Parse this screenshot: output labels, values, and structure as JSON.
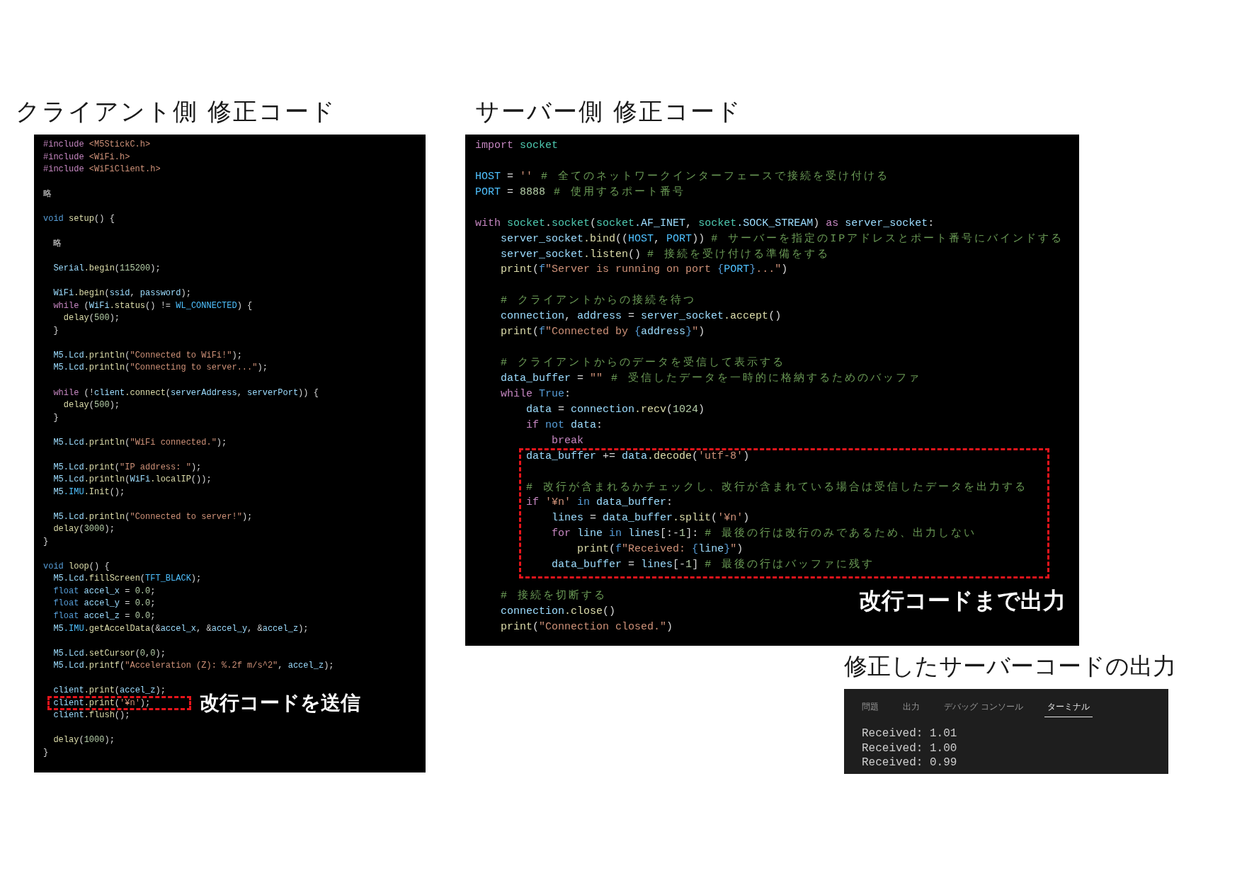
{
  "client_code": {
    "title": "クライアント側 修正コード",
    "sections": [
      {
        "highlighted": false,
        "lines": [
          {
            "kind": "code",
            "tokens": [
              {
                "kind": "keyword",
                "text": "#include"
              },
              {
                "kind": "string",
                "text": " <M5StickC.h>"
              }
            ]
          },
          {
            "kind": "code",
            "tokens": [
              {
                "kind": "keyword",
                "text": "#include"
              },
              {
                "kind": "string",
                "text": " <WiFi.h>"
              }
            ]
          },
          {
            "kind": "code",
            "tokens": [
              {
                "kind": "keyword",
                "text": "#include"
              },
              {
                "kind": "string",
                "text": " <WiFiClient.h>"
              }
            ]
          },
          {
            "kind": "blank"
          },
          {
            "kind": "code",
            "tokens": [
              {
                "kind": "plain",
                "text": "略"
              }
            ]
          },
          {
            "kind": "blank"
          },
          {
            "kind": "code",
            "tokens": [
              {
                "kind": "type",
                "text": "void"
              },
              {
                "kind": "function",
                "text": " setup"
              },
              {
                "kind": "plain",
                "text": "() {"
              }
            ]
          },
          {
            "kind": "blank"
          },
          {
            "kind": "code",
            "tokens": [
              {
                "kind": "plain",
                "text": "  略"
              }
            ]
          },
          {
            "kind": "blank"
          },
          {
            "kind": "code",
            "tokens": [
              {
                "kind": "variable",
                "text": "  Serial"
              },
              {
                "kind": "function",
                "text": ".begin"
              },
              {
                "kind": "plain",
                "text": "("
              },
              {
                "kind": "number",
                "text": "115200"
              },
              {
                "kind": "plain",
                "text": ");"
              }
            ]
          },
          {
            "kind": "blank"
          },
          {
            "kind": "code",
            "tokens": [
              {
                "kind": "variable",
                "text": "  WiFi"
              },
              {
                "kind": "function",
                "text": ".begin"
              },
              {
                "kind": "plain",
                "text": "("
              },
              {
                "kind": "variable",
                "text": "ssid"
              },
              {
                "kind": "plain",
                "text": ", "
              },
              {
                "kind": "variable",
                "text": "password"
              },
              {
                "kind": "plain",
                "text": ");"
              }
            ]
          },
          {
            "kind": "code",
            "tokens": [
              {
                "kind": "keyword",
                "text": "  while"
              },
              {
                "kind": "plain",
                "text": " ("
              },
              {
                "kind": "variable",
                "text": "WiFi"
              },
              {
                "kind": "function",
                "text": ".status"
              },
              {
                "kind": "plain",
                "text": "() != "
              },
              {
                "kind": "constant",
                "text": "WL_CONNECTED"
              },
              {
                "kind": "plain",
                "text": ") {"
              }
            ]
          },
          {
            "kind": "code",
            "tokens": [
              {
                "kind": "function",
                "text": "    delay"
              },
              {
                "kind": "plain",
                "text": "("
              },
              {
                "kind": "number",
                "text": "500"
              },
              {
                "kind": "plain",
                "text": ");"
              }
            ]
          },
          {
            "kind": "code",
            "tokens": [
              {
                "kind": "plain",
                "text": "  }"
              }
            ]
          },
          {
            "kind": "blank"
          },
          {
            "kind": "code",
            "tokens": [
              {
                "kind": "variable",
                "text": "  M5"
              },
              {
                "kind": "variable",
                "text": ".Lcd"
              },
              {
                "kind": "function",
                "text": ".println"
              },
              {
                "kind": "plain",
                "text": "("
              },
              {
                "kind": "string",
                "text": "\"Connected to WiFi!\""
              },
              {
                "kind": "plain",
                "text": ");"
              }
            ]
          },
          {
            "kind": "code",
            "tokens": [
              {
                "kind": "variable",
                "text": "  M5"
              },
              {
                "kind": "variable",
                "text": ".Lcd"
              },
              {
                "kind": "function",
                "text": ".println"
              },
              {
                "kind": "plain",
                "text": "("
              },
              {
                "kind": "string",
                "text": "\"Connecting to server...\""
              },
              {
                "kind": "plain",
                "text": ");"
              }
            ]
          },
          {
            "kind": "blank"
          },
          {
            "kind": "code",
            "tokens": [
              {
                "kind": "keyword",
                "text": "  while"
              },
              {
                "kind": "plain",
                "text": " (!"
              },
              {
                "kind": "variable",
                "text": "client"
              },
              {
                "kind": "function",
                "text": ".connect"
              },
              {
                "kind": "plain",
                "text": "("
              },
              {
                "kind": "variable",
                "text": "serverAddress"
              },
              {
                "kind": "plain",
                "text": ", "
              },
              {
                "kind": "variable",
                "text": "serverPort"
              },
              {
                "kind": "plain",
                "text": ")) {"
              }
            ]
          },
          {
            "kind": "code",
            "tokens": [
              {
                "kind": "function",
                "text": "    delay"
              },
              {
                "kind": "plain",
                "text": "("
              },
              {
                "kind": "number",
                "text": "500"
              },
              {
                "kind": "plain",
                "text": ");"
              }
            ]
          },
          {
            "kind": "code",
            "tokens": [
              {
                "kind": "plain",
                "text": "  }"
              }
            ]
          },
          {
            "kind": "blank"
          },
          {
            "kind": "code",
            "tokens": [
              {
                "kind": "variable",
                "text": "  M5"
              },
              {
                "kind": "variable",
                "text": ".Lcd"
              },
              {
                "kind": "function",
                "text": ".println"
              },
              {
                "kind": "plain",
                "text": "("
              },
              {
                "kind": "string",
                "text": "\"WiFi connected.\""
              },
              {
                "kind": "plain",
                "text": ");"
              }
            ]
          },
          {
            "kind": "blank"
          },
          {
            "kind": "code",
            "tokens": [
              {
                "kind": "variable",
                "text": "  M5"
              },
              {
                "kind": "variable",
                "text": ".Lcd"
              },
              {
                "kind": "function",
                "text": ".print"
              },
              {
                "kind": "plain",
                "text": "("
              },
              {
                "kind": "string",
                "text": "\"IP address: \""
              },
              {
                "kind": "plain",
                "text": ");"
              }
            ]
          },
          {
            "kind": "code",
            "tokens": [
              {
                "kind": "variable",
                "text": "  M5"
              },
              {
                "kind": "variable",
                "text": ".Lcd"
              },
              {
                "kind": "function",
                "text": ".println"
              },
              {
                "kind": "plain",
                "text": "("
              },
              {
                "kind": "variable",
                "text": "WiFi"
              },
              {
                "kind": "function",
                "text": ".localIP"
              },
              {
                "kind": "plain",
                "text": "());"
              }
            ]
          },
          {
            "kind": "code",
            "tokens": [
              {
                "kind": "variable",
                "text": "  M5"
              },
              {
                "kind": "constant",
                "text": ".IMU"
              },
              {
                "kind": "function",
                "text": ".Init"
              },
              {
                "kind": "plain",
                "text": "();"
              }
            ]
          },
          {
            "kind": "blank"
          },
          {
            "kind": "code",
            "tokens": [
              {
                "kind": "variable",
                "text": "  M5"
              },
              {
                "kind": "variable",
                "text": ".Lcd"
              },
              {
                "kind": "function",
                "text": ".println"
              },
              {
                "kind": "plain",
                "text": "("
              },
              {
                "kind": "string",
                "text": "\"Connected to server!\""
              },
              {
                "kind": "plain",
                "text": ");"
              }
            ]
          },
          {
            "kind": "code",
            "tokens": [
              {
                "kind": "function",
                "text": "  delay"
              },
              {
                "kind": "plain",
                "text": "("
              },
              {
                "kind": "number",
                "text": "3000"
              },
              {
                "kind": "plain",
                "text": ");"
              }
            ]
          },
          {
            "kind": "code",
            "tokens": [
              {
                "kind": "plain",
                "text": "}"
              }
            ]
          },
          {
            "kind": "blank"
          },
          {
            "kind": "code",
            "tokens": [
              {
                "kind": "type",
                "text": "void"
              },
              {
                "kind": "function",
                "text": " loop"
              },
              {
                "kind": "plain",
                "text": "() {"
              }
            ]
          },
          {
            "kind": "code",
            "tokens": [
              {
                "kind": "variable",
                "text": "  M5"
              },
              {
                "kind": "variable",
                "text": ".Lcd"
              },
              {
                "kind": "function",
                "text": ".fillScreen"
              },
              {
                "kind": "plain",
                "text": "("
              },
              {
                "kind": "constant",
                "text": "TFT_BLACK"
              },
              {
                "kind": "plain",
                "text": ");"
              }
            ]
          },
          {
            "kind": "code",
            "tokens": [
              {
                "kind": "type",
                "text": "  float"
              },
              {
                "kind": "variable",
                "text": " accel_x"
              },
              {
                "kind": "plain",
                "text": " = "
              },
              {
                "kind": "number",
                "text": "0.0"
              },
              {
                "kind": "plain",
                "text": ";"
              }
            ]
          },
          {
            "kind": "code",
            "tokens": [
              {
                "kind": "type",
                "text": "  float"
              },
              {
                "kind": "variable",
                "text": " accel_y"
              },
              {
                "kind": "plain",
                "text": " = "
              },
              {
                "kind": "number",
                "text": "0.0"
              },
              {
                "kind": "plain",
                "text": ";"
              }
            ]
          },
          {
            "kind": "code",
            "tokens": [
              {
                "kind": "type",
                "text": "  float"
              },
              {
                "kind": "variable",
                "text": " accel_z"
              },
              {
                "kind": "plain",
                "text": " = "
              },
              {
                "kind": "number",
                "text": "0.0"
              },
              {
                "kind": "plain",
                "text": ";"
              }
            ]
          },
          {
            "kind": "code",
            "tokens": [
              {
                "kind": "variable",
                "text": "  M5"
              },
              {
                "kind": "constant",
                "text": ".IMU"
              },
              {
                "kind": "function",
                "text": ".getAccelData"
              },
              {
                "kind": "plain",
                "text": "(&"
              },
              {
                "kind": "variable",
                "text": "accel_x"
              },
              {
                "kind": "plain",
                "text": ", &"
              },
              {
                "kind": "variable",
                "text": "accel_y"
              },
              {
                "kind": "plain",
                "text": ", &"
              },
              {
                "kind": "variable",
                "text": "accel_z"
              },
              {
                "kind": "plain",
                "text": ");"
              }
            ]
          },
          {
            "kind": "blank"
          },
          {
            "kind": "code",
            "tokens": [
              {
                "kind": "variable",
                "text": "  M5"
              },
              {
                "kind": "variable",
                "text": ".Lcd"
              },
              {
                "kind": "function",
                "text": ".setCursor"
              },
              {
                "kind": "plain",
                "text": "("
              },
              {
                "kind": "number",
                "text": "0"
              },
              {
                "kind": "plain",
                "text": ","
              },
              {
                "kind": "number",
                "text": "0"
              },
              {
                "kind": "plain",
                "text": ");"
              }
            ]
          },
          {
            "kind": "code",
            "tokens": [
              {
                "kind": "variable",
                "text": "  M5"
              },
              {
                "kind": "variable",
                "text": ".Lcd"
              },
              {
                "kind": "function",
                "text": ".printf"
              },
              {
                "kind": "plain",
                "text": "("
              },
              {
                "kind": "string",
                "text": "\"Acceleration (Z): %.2f m/s^2\""
              },
              {
                "kind": "plain",
                "text": ", "
              },
              {
                "kind": "variable",
                "text": "accel_z"
              },
              {
                "kind": "plain",
                "text": ");"
              }
            ]
          },
          {
            "kind": "blank"
          },
          {
            "kind": "code",
            "tokens": [
              {
                "kind": "variable",
                "text": "  client"
              },
              {
                "kind": "function",
                "text": ".print"
              },
              {
                "kind": "plain",
                "text": "("
              },
              {
                "kind": "variable",
                "text": "accel_z"
              },
              {
                "kind": "plain",
                "text": ");"
              }
            ]
          }
        ]
      },
      {
        "highlighted": true,
        "annotation": "改行コードを送信",
        "lines": [
          {
            "kind": "code",
            "tokens": [
              {
                "kind": "variable",
                "text": "  client"
              },
              {
                "kind": "function",
                "text": ".print"
              },
              {
                "kind": "plain",
                "text": "("
              },
              {
                "kind": "string",
                "text": "'¥n'"
              },
              {
                "kind": "plain",
                "text": ");"
              }
            ]
          }
        ]
      },
      {
        "highlighted": false,
        "lines": [
          {
            "kind": "code",
            "tokens": [
              {
                "kind": "variable",
                "text": "  client"
              },
              {
                "kind": "function",
                "text": ".flush"
              },
              {
                "kind": "plain",
                "text": "();"
              }
            ]
          },
          {
            "kind": "blank"
          },
          {
            "kind": "code",
            "tokens": [
              {
                "kind": "function",
                "text": "  delay"
              },
              {
                "kind": "plain",
                "text": "("
              },
              {
                "kind": "number",
                "text": "1000"
              },
              {
                "kind": "plain",
                "text": ");"
              }
            ]
          },
          {
            "kind": "code",
            "tokens": [
              {
                "kind": "plain",
                "text": "}"
              }
            ]
          }
        ]
      }
    ]
  },
  "server_code": {
    "title": "サーバー側 修正コード",
    "sections": [
      {
        "highlighted": false,
        "lines": [
          {
            "kind": "code",
            "tokens": [
              {
                "kind": "keyword",
                "text": "import"
              },
              {
                "kind": "module",
                "text": " socket"
              }
            ]
          },
          {
            "kind": "blank"
          },
          {
            "kind": "code",
            "tokens": [
              {
                "kind": "constant",
                "text": "HOST"
              },
              {
                "kind": "plain",
                "text": " = "
              },
              {
                "kind": "string",
                "text": "''"
              },
              {
                "kind": "comment",
                "text": " # 全てのネットワークインターフェースで接続を受け付ける"
              }
            ]
          },
          {
            "kind": "code",
            "tokens": [
              {
                "kind": "constant",
                "text": "PORT"
              },
              {
                "kind": "plain",
                "text": " = "
              },
              {
                "kind": "number",
                "text": "8888"
              },
              {
                "kind": "comment",
                "text": " # 使用するポート番号"
              }
            ]
          },
          {
            "kind": "blank"
          },
          {
            "kind": "code",
            "tokens": [
              {
                "kind": "keyword",
                "text": "with"
              },
              {
                "kind": "module",
                "text": " socket"
              },
              {
                "kind": "plain",
                "text": "."
              },
              {
                "kind": "module",
                "text": "socket"
              },
              {
                "kind": "plain",
                "text": "("
              },
              {
                "kind": "module",
                "text": "socket"
              },
              {
                "kind": "variable",
                "text": ".AF_INET"
              },
              {
                "kind": "plain",
                "text": ", "
              },
              {
                "kind": "module",
                "text": "socket"
              },
              {
                "kind": "variable",
                "text": ".SOCK_STREAM"
              },
              {
                "kind": "plain",
                "text": ") "
              },
              {
                "kind": "keyword",
                "text": "as"
              },
              {
                "kind": "variable",
                "text": " server_socket"
              },
              {
                "kind": "plain",
                "text": ":"
              }
            ]
          },
          {
            "kind": "code",
            "tokens": [
              {
                "kind": "variable",
                "text": "    server_socket"
              },
              {
                "kind": "function",
                "text": ".bind"
              },
              {
                "kind": "plain",
                "text": "(("
              },
              {
                "kind": "constant",
                "text": "HOST"
              },
              {
                "kind": "plain",
                "text": ", "
              },
              {
                "kind": "constant",
                "text": "PORT"
              },
              {
                "kind": "plain",
                "text": ")) "
              },
              {
                "kind": "comment",
                "text": "# サーバーを指定のIPアドレスとポート番号にバインドする"
              }
            ]
          },
          {
            "kind": "code",
            "tokens": [
              {
                "kind": "variable",
                "text": "    server_socket"
              },
              {
                "kind": "function",
                "text": ".listen"
              },
              {
                "kind": "plain",
                "text": "() "
              },
              {
                "kind": "comment",
                "text": "# 接続を受け付ける準備をする"
              }
            ]
          },
          {
            "kind": "code",
            "tokens": [
              {
                "kind": "function",
                "text": "    print"
              },
              {
                "kind": "plain",
                "text": "("
              },
              {
                "kind": "type",
                "text": "f"
              },
              {
                "kind": "string",
                "text": "\"Server is running on port "
              },
              {
                "kind": "type",
                "text": "{"
              },
              {
                "kind": "constant",
                "text": "PORT"
              },
              {
                "kind": "type",
                "text": "}"
              },
              {
                "kind": "string",
                "text": "...\""
              },
              {
                "kind": "plain",
                "text": ")"
              }
            ]
          },
          {
            "kind": "blank"
          },
          {
            "kind": "code",
            "tokens": [
              {
                "kind": "comment",
                "text": "    # クライアントからの接続を待つ"
              }
            ]
          },
          {
            "kind": "code",
            "tokens": [
              {
                "kind": "variable",
                "text": "    connection"
              },
              {
                "kind": "plain",
                "text": ", "
              },
              {
                "kind": "variable",
                "text": "address"
              },
              {
                "kind": "plain",
                "text": " = "
              },
              {
                "kind": "variable",
                "text": "server_socket"
              },
              {
                "kind": "function",
                "text": ".accept"
              },
              {
                "kind": "plain",
                "text": "()"
              }
            ]
          },
          {
            "kind": "code",
            "tokens": [
              {
                "kind": "function",
                "text": "    print"
              },
              {
                "kind": "plain",
                "text": "("
              },
              {
                "kind": "type",
                "text": "f"
              },
              {
                "kind": "string",
                "text": "\"Connected by "
              },
              {
                "kind": "type",
                "text": "{"
              },
              {
                "kind": "variable",
                "text": "address"
              },
              {
                "kind": "type",
                "text": "}"
              },
              {
                "kind": "string",
                "text": "\""
              },
              {
                "kind": "plain",
                "text": ")"
              }
            ]
          },
          {
            "kind": "blank"
          },
          {
            "kind": "code",
            "tokens": [
              {
                "kind": "comment",
                "text": "    # クライアントからのデータを受信して表示する"
              }
            ]
          },
          {
            "kind": "code",
            "tokens": [
              {
                "kind": "variable",
                "text": "    data_buffer"
              },
              {
                "kind": "plain",
                "text": " = "
              },
              {
                "kind": "string",
                "text": "\"\""
              },
              {
                "kind": "comment",
                "text": " # 受信したデータを一時的に格納するためのバッファ"
              }
            ]
          },
          {
            "kind": "code",
            "tokens": [
              {
                "kind": "keyword",
                "text": "    while"
              },
              {
                "kind": "type",
                "text": " True"
              },
              {
                "kind": "plain",
                "text": ":"
              }
            ]
          },
          {
            "kind": "code",
            "tokens": [
              {
                "kind": "variable",
                "text": "        data"
              },
              {
                "kind": "plain",
                "text": " = "
              },
              {
                "kind": "variable",
                "text": "connection"
              },
              {
                "kind": "function",
                "text": ".recv"
              },
              {
                "kind": "plain",
                "text": "("
              },
              {
                "kind": "number",
                "text": "1024"
              },
              {
                "kind": "plain",
                "text": ")"
              }
            ]
          },
          {
            "kind": "code",
            "tokens": [
              {
                "kind": "keyword",
                "text": "        if"
              },
              {
                "kind": "type",
                "text": " not"
              },
              {
                "kind": "variable",
                "text": " data"
              },
              {
                "kind": "plain",
                "text": ":"
              }
            ]
          },
          {
            "kind": "code",
            "tokens": [
              {
                "kind": "keyword",
                "text": "            break"
              }
            ]
          }
        ]
      },
      {
        "highlighted": true,
        "annotation": "改行コードまで出力",
        "lines": [
          {
            "kind": "code",
            "tokens": [
              {
                "kind": "variable",
                "text": "        data_buffer"
              },
              {
                "kind": "plain",
                "text": " += "
              },
              {
                "kind": "variable",
                "text": "data"
              },
              {
                "kind": "function",
                "text": ".decode"
              },
              {
                "kind": "plain",
                "text": "("
              },
              {
                "kind": "string",
                "text": "'utf-8'"
              },
              {
                "kind": "plain",
                "text": ")"
              }
            ]
          },
          {
            "kind": "blank"
          },
          {
            "kind": "code",
            "tokens": [
              {
                "kind": "comment",
                "text": "        # 改行が含まれるかチェックし、改行が含まれている場合は受信したデータを出力する"
              }
            ]
          },
          {
            "kind": "code",
            "tokens": [
              {
                "kind": "keyword",
                "text": "        if"
              },
              {
                "kind": "string",
                "text": " '¥n'"
              },
              {
                "kind": "type",
                "text": " in"
              },
              {
                "kind": "variable",
                "text": " data_buffer"
              },
              {
                "kind": "plain",
                "text": ":"
              }
            ]
          },
          {
            "kind": "code",
            "tokens": [
              {
                "kind": "variable",
                "text": "            lines"
              },
              {
                "kind": "plain",
                "text": " = "
              },
              {
                "kind": "variable",
                "text": "data_buffer"
              },
              {
                "kind": "function",
                "text": ".split"
              },
              {
                "kind": "plain",
                "text": "("
              },
              {
                "kind": "string",
                "text": "'¥n'"
              },
              {
                "kind": "plain",
                "text": ")"
              }
            ]
          },
          {
            "kind": "code",
            "tokens": [
              {
                "kind": "keyword",
                "text": "            for"
              },
              {
                "kind": "variable",
                "text": " line"
              },
              {
                "kind": "type",
                "text": " in"
              },
              {
                "kind": "variable",
                "text": " lines"
              },
              {
                "kind": "plain",
                "text": "[:-"
              },
              {
                "kind": "number",
                "text": "1"
              },
              {
                "kind": "plain",
                "text": "]: "
              },
              {
                "kind": "comment",
                "text": "# 最後の行は改行のみであるため、出力しない"
              }
            ]
          },
          {
            "kind": "code",
            "tokens": [
              {
                "kind": "function",
                "text": "                print"
              },
              {
                "kind": "plain",
                "text": "("
              },
              {
                "kind": "type",
                "text": "f"
              },
              {
                "kind": "string",
                "text": "\"Received: "
              },
              {
                "kind": "type",
                "text": "{"
              },
              {
                "kind": "variable",
                "text": "line"
              },
              {
                "kind": "type",
                "text": "}"
              },
              {
                "kind": "string",
                "text": "\""
              },
              {
                "kind": "plain",
                "text": ")"
              }
            ]
          },
          {
            "kind": "code",
            "tokens": [
              {
                "kind": "variable",
                "text": "            data_buffer"
              },
              {
                "kind": "plain",
                "text": " = "
              },
              {
                "kind": "variable",
                "text": "lines"
              },
              {
                "kind": "plain",
                "text": "[-"
              },
              {
                "kind": "number",
                "text": "1"
              },
              {
                "kind": "plain",
                "text": "] "
              },
              {
                "kind": "comment",
                "text": "# 最後の行はバッファに残す"
              }
            ]
          }
        ]
      },
      {
        "highlighted": false,
        "lines": [
          {
            "kind": "blank"
          },
          {
            "kind": "code",
            "tokens": [
              {
                "kind": "comment",
                "text": "    # 接続を切断する"
              }
            ]
          },
          {
            "kind": "code",
            "tokens": [
              {
                "kind": "variable",
                "text": "    connection"
              },
              {
                "kind": "function",
                "text": ".close"
              },
              {
                "kind": "plain",
                "text": "()"
              }
            ]
          },
          {
            "kind": "code",
            "tokens": [
              {
                "kind": "function",
                "text": "    print"
              },
              {
                "kind": "plain",
                "text": "("
              },
              {
                "kind": "string",
                "text": "\"Connection closed.\""
              },
              {
                "kind": "plain",
                "text": ")"
              }
            ]
          }
        ]
      }
    ]
  },
  "output": {
    "title": "修正したサーバーコードの出力",
    "terminal": {
      "tabs": [
        {
          "label": "問題",
          "selected": false
        },
        {
          "label": "出力",
          "selected": false
        },
        {
          "label": "デバッグ コンソール",
          "selected": false
        },
        {
          "label": "ターミナル",
          "selected": true
        }
      ],
      "lines": [
        "Received: 1.01",
        "Received: 1.00",
        "Received: 0.99"
      ]
    }
  }
}
